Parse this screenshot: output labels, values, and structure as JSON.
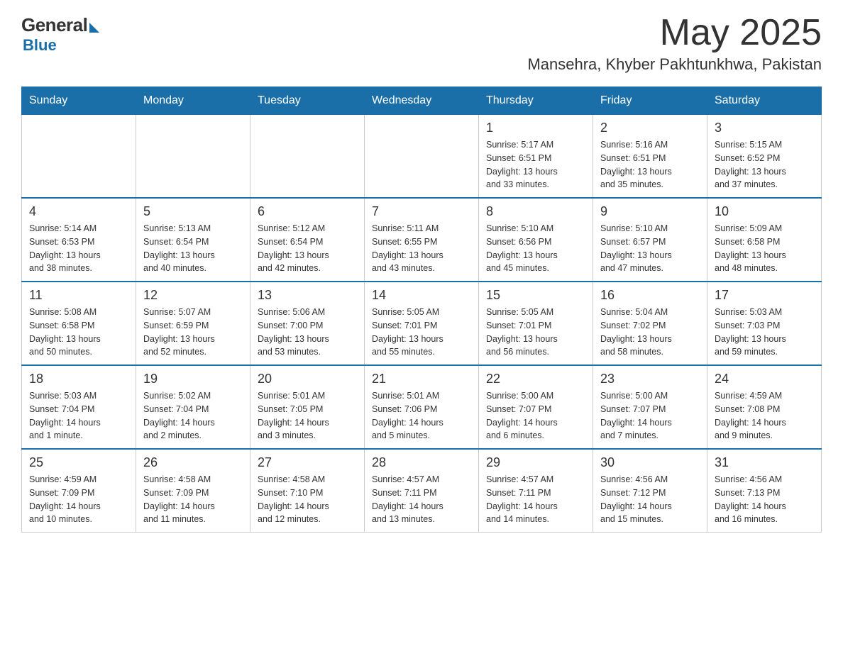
{
  "logo": {
    "general": "General",
    "blue": "Blue"
  },
  "title": {
    "month": "May 2025",
    "location": "Mansehra, Khyber Pakhtunkhwa, Pakistan"
  },
  "weekdays": [
    "Sunday",
    "Monday",
    "Tuesday",
    "Wednesday",
    "Thursday",
    "Friday",
    "Saturday"
  ],
  "weeks": [
    [
      {
        "day": "",
        "info": ""
      },
      {
        "day": "",
        "info": ""
      },
      {
        "day": "",
        "info": ""
      },
      {
        "day": "",
        "info": ""
      },
      {
        "day": "1",
        "info": "Sunrise: 5:17 AM\nSunset: 6:51 PM\nDaylight: 13 hours\nand 33 minutes."
      },
      {
        "day": "2",
        "info": "Sunrise: 5:16 AM\nSunset: 6:51 PM\nDaylight: 13 hours\nand 35 minutes."
      },
      {
        "day": "3",
        "info": "Sunrise: 5:15 AM\nSunset: 6:52 PM\nDaylight: 13 hours\nand 37 minutes."
      }
    ],
    [
      {
        "day": "4",
        "info": "Sunrise: 5:14 AM\nSunset: 6:53 PM\nDaylight: 13 hours\nand 38 minutes."
      },
      {
        "day": "5",
        "info": "Sunrise: 5:13 AM\nSunset: 6:54 PM\nDaylight: 13 hours\nand 40 minutes."
      },
      {
        "day": "6",
        "info": "Sunrise: 5:12 AM\nSunset: 6:54 PM\nDaylight: 13 hours\nand 42 minutes."
      },
      {
        "day": "7",
        "info": "Sunrise: 5:11 AM\nSunset: 6:55 PM\nDaylight: 13 hours\nand 43 minutes."
      },
      {
        "day": "8",
        "info": "Sunrise: 5:10 AM\nSunset: 6:56 PM\nDaylight: 13 hours\nand 45 minutes."
      },
      {
        "day": "9",
        "info": "Sunrise: 5:10 AM\nSunset: 6:57 PM\nDaylight: 13 hours\nand 47 minutes."
      },
      {
        "day": "10",
        "info": "Sunrise: 5:09 AM\nSunset: 6:58 PM\nDaylight: 13 hours\nand 48 minutes."
      }
    ],
    [
      {
        "day": "11",
        "info": "Sunrise: 5:08 AM\nSunset: 6:58 PM\nDaylight: 13 hours\nand 50 minutes."
      },
      {
        "day": "12",
        "info": "Sunrise: 5:07 AM\nSunset: 6:59 PM\nDaylight: 13 hours\nand 52 minutes."
      },
      {
        "day": "13",
        "info": "Sunrise: 5:06 AM\nSunset: 7:00 PM\nDaylight: 13 hours\nand 53 minutes."
      },
      {
        "day": "14",
        "info": "Sunrise: 5:05 AM\nSunset: 7:01 PM\nDaylight: 13 hours\nand 55 minutes."
      },
      {
        "day": "15",
        "info": "Sunrise: 5:05 AM\nSunset: 7:01 PM\nDaylight: 13 hours\nand 56 minutes."
      },
      {
        "day": "16",
        "info": "Sunrise: 5:04 AM\nSunset: 7:02 PM\nDaylight: 13 hours\nand 58 minutes."
      },
      {
        "day": "17",
        "info": "Sunrise: 5:03 AM\nSunset: 7:03 PM\nDaylight: 13 hours\nand 59 minutes."
      }
    ],
    [
      {
        "day": "18",
        "info": "Sunrise: 5:03 AM\nSunset: 7:04 PM\nDaylight: 14 hours\nand 1 minute."
      },
      {
        "day": "19",
        "info": "Sunrise: 5:02 AM\nSunset: 7:04 PM\nDaylight: 14 hours\nand 2 minutes."
      },
      {
        "day": "20",
        "info": "Sunrise: 5:01 AM\nSunset: 7:05 PM\nDaylight: 14 hours\nand 3 minutes."
      },
      {
        "day": "21",
        "info": "Sunrise: 5:01 AM\nSunset: 7:06 PM\nDaylight: 14 hours\nand 5 minutes."
      },
      {
        "day": "22",
        "info": "Sunrise: 5:00 AM\nSunset: 7:07 PM\nDaylight: 14 hours\nand 6 minutes."
      },
      {
        "day": "23",
        "info": "Sunrise: 5:00 AM\nSunset: 7:07 PM\nDaylight: 14 hours\nand 7 minutes."
      },
      {
        "day": "24",
        "info": "Sunrise: 4:59 AM\nSunset: 7:08 PM\nDaylight: 14 hours\nand 9 minutes."
      }
    ],
    [
      {
        "day": "25",
        "info": "Sunrise: 4:59 AM\nSunset: 7:09 PM\nDaylight: 14 hours\nand 10 minutes."
      },
      {
        "day": "26",
        "info": "Sunrise: 4:58 AM\nSunset: 7:09 PM\nDaylight: 14 hours\nand 11 minutes."
      },
      {
        "day": "27",
        "info": "Sunrise: 4:58 AM\nSunset: 7:10 PM\nDaylight: 14 hours\nand 12 minutes."
      },
      {
        "day": "28",
        "info": "Sunrise: 4:57 AM\nSunset: 7:11 PM\nDaylight: 14 hours\nand 13 minutes."
      },
      {
        "day": "29",
        "info": "Sunrise: 4:57 AM\nSunset: 7:11 PM\nDaylight: 14 hours\nand 14 minutes."
      },
      {
        "day": "30",
        "info": "Sunrise: 4:56 AM\nSunset: 7:12 PM\nDaylight: 14 hours\nand 15 minutes."
      },
      {
        "day": "31",
        "info": "Sunrise: 4:56 AM\nSunset: 7:13 PM\nDaylight: 14 hours\nand 16 minutes."
      }
    ]
  ]
}
